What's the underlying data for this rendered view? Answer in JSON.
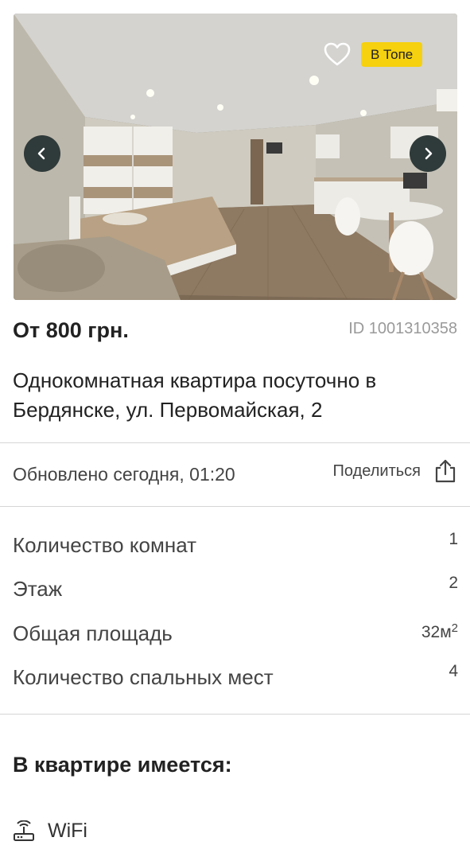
{
  "gallery": {
    "badge": "В Топе"
  },
  "listing": {
    "price": "От 800 грн.",
    "id": "ID 1001310358",
    "title": "Однокомнатная квартира посуточно в Бердянске, ул. Первомайская, 2"
  },
  "meta": {
    "updated": "Обновлено сегодня, 01:20",
    "share_label": "Поделиться"
  },
  "properties": [
    {
      "label": "Количество комнат",
      "value": "1"
    },
    {
      "label": "Этаж",
      "value": "2"
    },
    {
      "label": "Общая площадь",
      "value": "32м",
      "sup": "2"
    },
    {
      "label": "Количество спальных мест",
      "value": "4"
    }
  ],
  "amenities": {
    "title": "В квартире имеется:",
    "items": [
      {
        "label": "WiFi",
        "icon": "wifi-router-icon"
      }
    ]
  }
}
